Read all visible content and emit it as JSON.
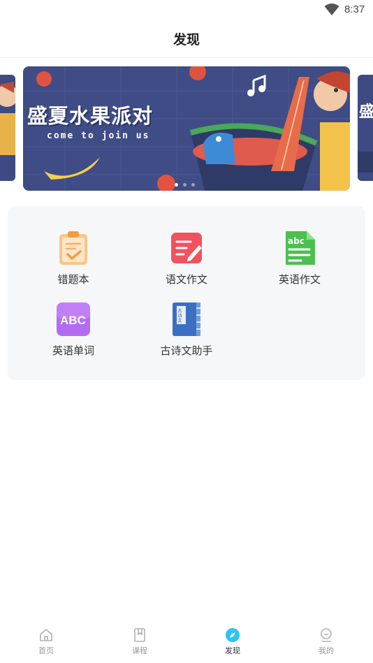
{
  "status_bar": {
    "time": "8:37"
  },
  "header": {
    "title": "发现"
  },
  "banner": {
    "headline": "盛夏水果派对",
    "subtitle": "come to join us",
    "dots_count": 3,
    "active_dot": 0
  },
  "features": [
    {
      "label": "错题本",
      "icon": "clipboard-check-icon"
    },
    {
      "label": "语文作文",
      "icon": "pen-document-icon"
    },
    {
      "label": "英语作文",
      "icon": "abc-document-icon"
    },
    {
      "label": "英语单词",
      "icon": "abc-card-icon"
    },
    {
      "label": "古诗文助手",
      "icon": "poetry-book-icon"
    }
  ],
  "tabbar": [
    {
      "label": "首页",
      "icon": "home-icon",
      "active": false
    },
    {
      "label": "课程",
      "icon": "book-icon",
      "active": false
    },
    {
      "label": "发现",
      "icon": "compass-icon",
      "active": true
    },
    {
      "label": "我的",
      "icon": "profile-icon",
      "active": false
    }
  ],
  "colors": {
    "accent": "#2ec3f5",
    "panel_bg": "#f6f7f9",
    "banner_bg": "#3e4a82"
  }
}
